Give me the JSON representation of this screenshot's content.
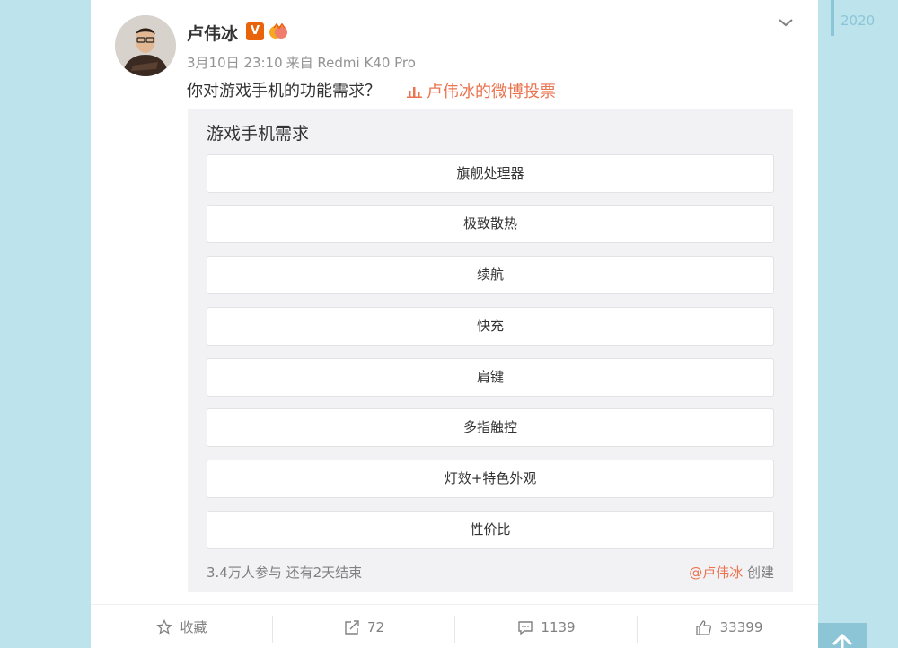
{
  "post": {
    "username": "卢伟冰",
    "verified_badge": "V",
    "date": "3月10日 23:10",
    "source": "来自 Redmi K40 Pro",
    "text": "你对游戏手机的功能需求？",
    "poll_link": "卢伟冰的微博投票"
  },
  "poll": {
    "title": "游戏手机需求",
    "options": [
      "旗舰处理器",
      "极致散热",
      "续航",
      "快充",
      "肩键",
      "多指触控",
      "灯效+特色外观",
      "性价比"
    ],
    "stats": "3.4万人参与 还有2天结束",
    "creator_mention": "@卢伟冰",
    "creator_suffix": "创建"
  },
  "actions": {
    "favorite_label": "收藏",
    "repost_count": "72",
    "comment_count": "1139",
    "like_count": "33399"
  },
  "timeline": {
    "year": "2020"
  },
  "colors": {
    "page_bg": "#bde3ec",
    "accent": "#eb7350",
    "poll_bg": "#f2f2f5",
    "timeline": "#8cc6d6"
  }
}
